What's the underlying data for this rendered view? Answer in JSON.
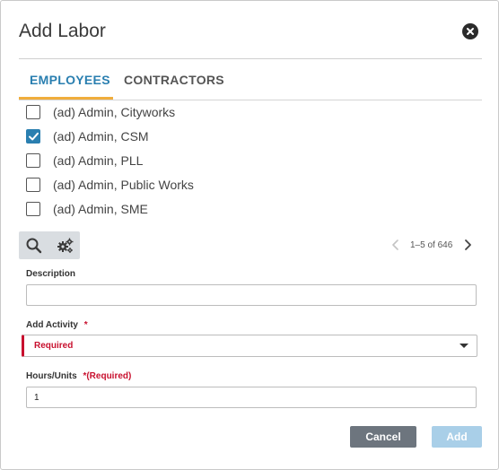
{
  "dialog": {
    "title": "Add Labor"
  },
  "tabs": [
    {
      "label": "EMPLOYEES",
      "active": true
    },
    {
      "label": "CONTRACTORS",
      "active": false
    }
  ],
  "employees": [
    {
      "name": "(ad) Admin, Cityworks",
      "checked": false
    },
    {
      "name": "(ad) Admin, CSM",
      "checked": true
    },
    {
      "name": "(ad) Admin, PLL",
      "checked": false
    },
    {
      "name": "(ad) Admin, Public Works",
      "checked": false
    },
    {
      "name": "(ad) Admin, SME",
      "checked": false
    }
  ],
  "pager": {
    "text": "1–5 of 646"
  },
  "form": {
    "description_label": "Description",
    "description_value": "",
    "activity_label": "Add Activity",
    "activity_star": "*",
    "activity_value": "Required",
    "hours_label": "Hours/Units",
    "hours_required": "*(Required)",
    "hours_value": "1"
  },
  "buttons": {
    "cancel": "Cancel",
    "add": "Add"
  },
  "icons": {
    "close": "close-circle-icon",
    "search": "search-icon",
    "settings": "gears-icon",
    "prev": "chevron-left-icon",
    "next": "chevron-right-icon",
    "check": "checkmark-icon",
    "dropdown": "caret-down-icon"
  },
  "colors": {
    "accent_blue": "#2a7fb0",
    "tab_underline": "#f0ad3c",
    "required_red": "#c8102e",
    "cancel_bg": "#6d757e",
    "add_bg_disabled": "#a9cfe8"
  }
}
